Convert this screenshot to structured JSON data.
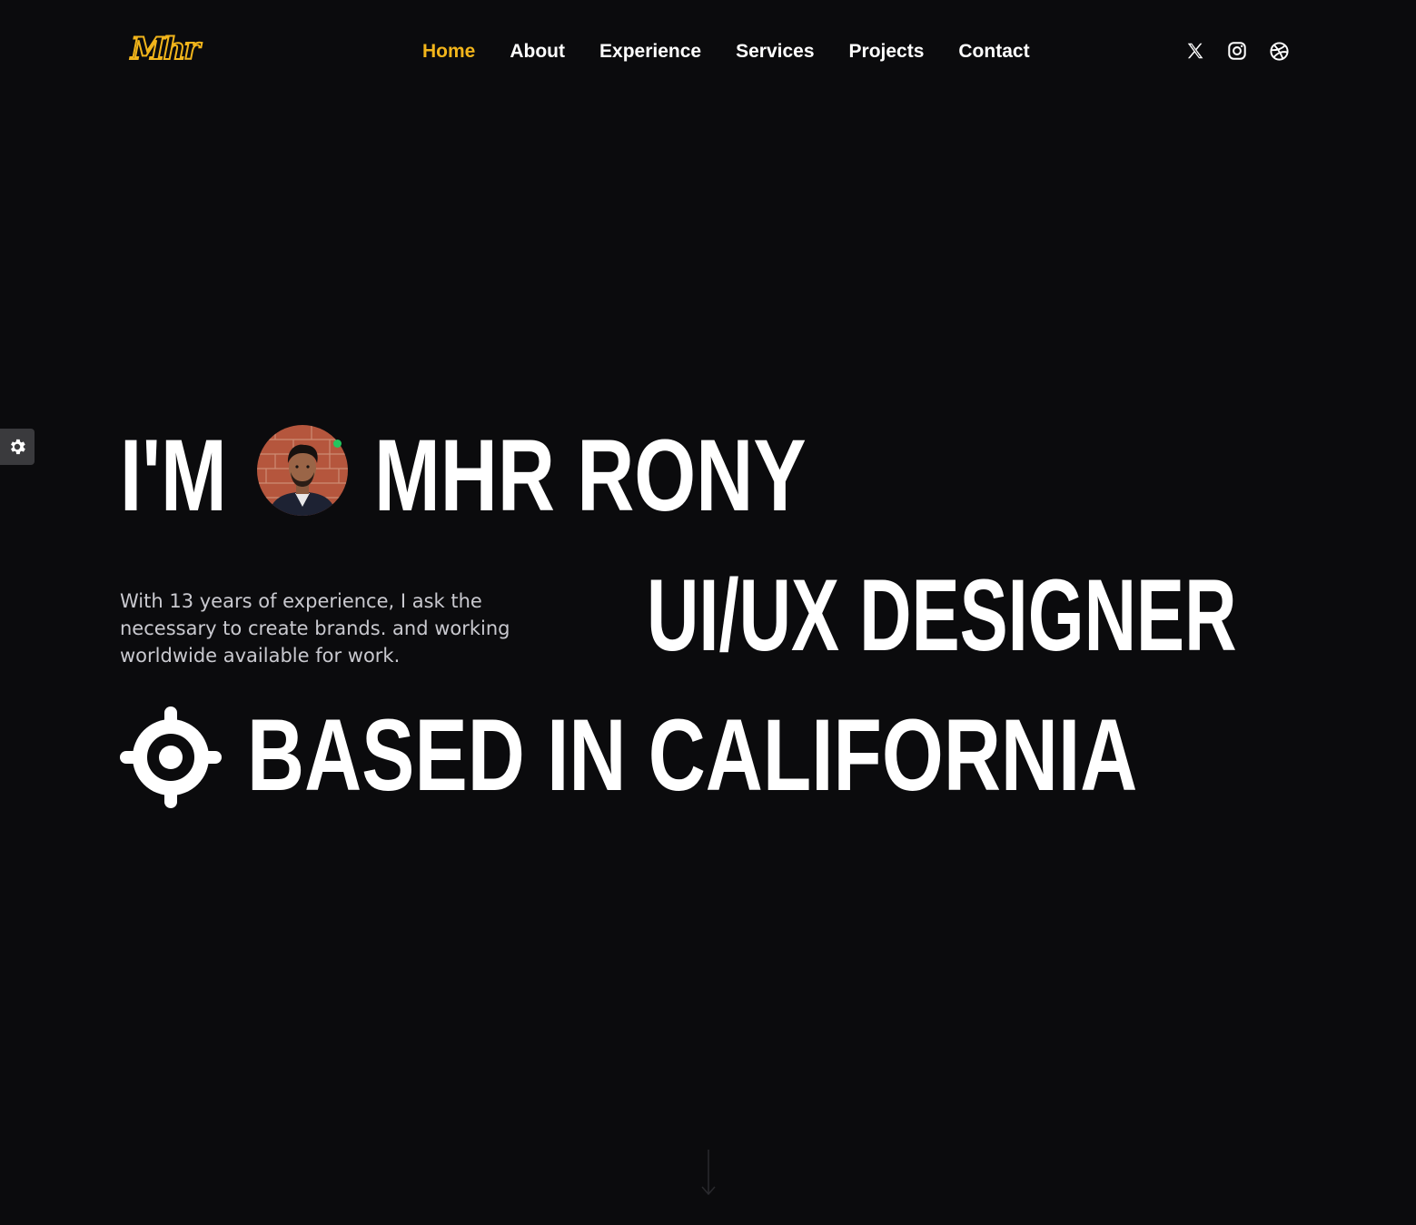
{
  "header": {
    "logo_text": "Mhr",
    "nav": [
      {
        "label": "Home",
        "active": true
      },
      {
        "label": "About",
        "active": false
      },
      {
        "label": "Experience",
        "active": false
      },
      {
        "label": "Services",
        "active": false
      },
      {
        "label": "Projects",
        "active": false
      },
      {
        "label": "Contact",
        "active": false
      }
    ],
    "socials": [
      "x-icon",
      "instagram-icon",
      "dribbble-icon"
    ]
  },
  "settings": {
    "icon": "gear-icon"
  },
  "hero": {
    "prefix": "I'M",
    "name": "MHR RONY",
    "role": "UI/UX DESIGNER",
    "location_line": "BASED IN CALIFORNIA",
    "bio": "With 13 years of experience, I ask the necessary to create brands. and working worldwide available for work.",
    "avatar_online": true,
    "location_icon": "target-icon",
    "scroll_icon": "arrow-down-icon"
  },
  "colors": {
    "background": "#0b0b0d",
    "accent": "#f2b51b",
    "text": "#ffffff",
    "muted": "#c9c9cf",
    "online": "#23c45e"
  }
}
